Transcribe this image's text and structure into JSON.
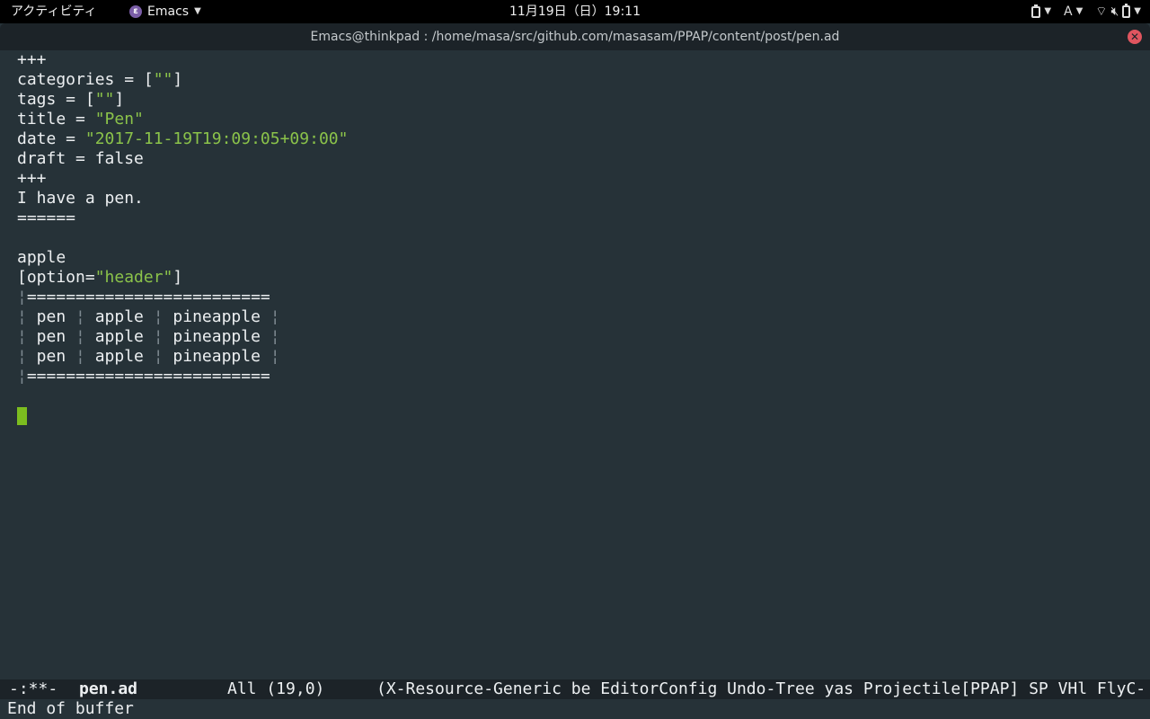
{
  "topbar": {
    "activities": "アクティビティ",
    "app_name": "Emacs",
    "clock": "11月19日（日）19:11",
    "input_method": "A"
  },
  "window": {
    "title": "Emacs@thinkpad : /home/masa/src/github.com/masasam/PPAP/content/post/pen.ad"
  },
  "buffer": {
    "lines": [
      [
        {
          "t": "+++"
        }
      ],
      [
        {
          "t": "categories = ["
        },
        {
          "t": "\"\"",
          "c": "str"
        },
        {
          "t": "]"
        }
      ],
      [
        {
          "t": "tags = ["
        },
        {
          "t": "\"\"",
          "c": "str"
        },
        {
          "t": "]"
        }
      ],
      [
        {
          "t": "title = "
        },
        {
          "t": "\"Pen\"",
          "c": "str"
        }
      ],
      [
        {
          "t": "date = "
        },
        {
          "t": "\"2017-11-19T19:09:05+09:00\"",
          "c": "str"
        }
      ],
      [
        {
          "t": "draft = false"
        }
      ],
      [
        {
          "t": "+++"
        }
      ],
      [
        {
          "t": "I have a pen."
        }
      ],
      [
        {
          "t": "======"
        }
      ],
      [],
      [
        {
          "t": "apple"
        }
      ],
      [
        {
          "t": "[option="
        },
        {
          "t": "\"header\"",
          "c": "str"
        },
        {
          "t": "]"
        }
      ],
      [
        {
          "t": "¦",
          "c": "dim"
        },
        {
          "t": "========================="
        }
      ],
      [
        {
          "t": "¦",
          "c": "dim"
        },
        {
          "t": " pen "
        },
        {
          "t": "¦",
          "c": "dim"
        },
        {
          "t": " apple "
        },
        {
          "t": "¦",
          "c": "dim"
        },
        {
          "t": " pineapple "
        },
        {
          "t": "¦",
          "c": "dim"
        }
      ],
      [
        {
          "t": "¦",
          "c": "dim"
        },
        {
          "t": " pen "
        },
        {
          "t": "¦",
          "c": "dim"
        },
        {
          "t": " apple "
        },
        {
          "t": "¦",
          "c": "dim"
        },
        {
          "t": " pineapple "
        },
        {
          "t": "¦",
          "c": "dim"
        }
      ],
      [
        {
          "t": "¦",
          "c": "dim"
        },
        {
          "t": " pen "
        },
        {
          "t": "¦",
          "c": "dim"
        },
        {
          "t": " apple "
        },
        {
          "t": "¦",
          "c": "dim"
        },
        {
          "t": " pineapple "
        },
        {
          "t": "¦",
          "c": "dim"
        }
      ],
      [
        {
          "t": "¦",
          "c": "dim"
        },
        {
          "t": "========================="
        }
      ],
      [],
      "cursor"
    ]
  },
  "modeline": {
    "flags": "-:**-",
    "buffer_name": "pen.ad",
    "position": "All (19,0)",
    "modes": "(X-Resource-Generic be EditorConfig Undo-Tree yas Projectile[PPAP] SP VHl FlyC-"
  },
  "echo": {
    "message": "End of buffer"
  },
  "colors": {
    "background": "#263238",
    "string": "#8bc34a",
    "cursor": "#7cbd1f",
    "close_button": "#e0555f"
  },
  "icons": [
    "emacs-app-icon",
    "clipboard-icon",
    "wifi-icon",
    "speaker-muted-icon",
    "battery-icon",
    "close-icon"
  ]
}
